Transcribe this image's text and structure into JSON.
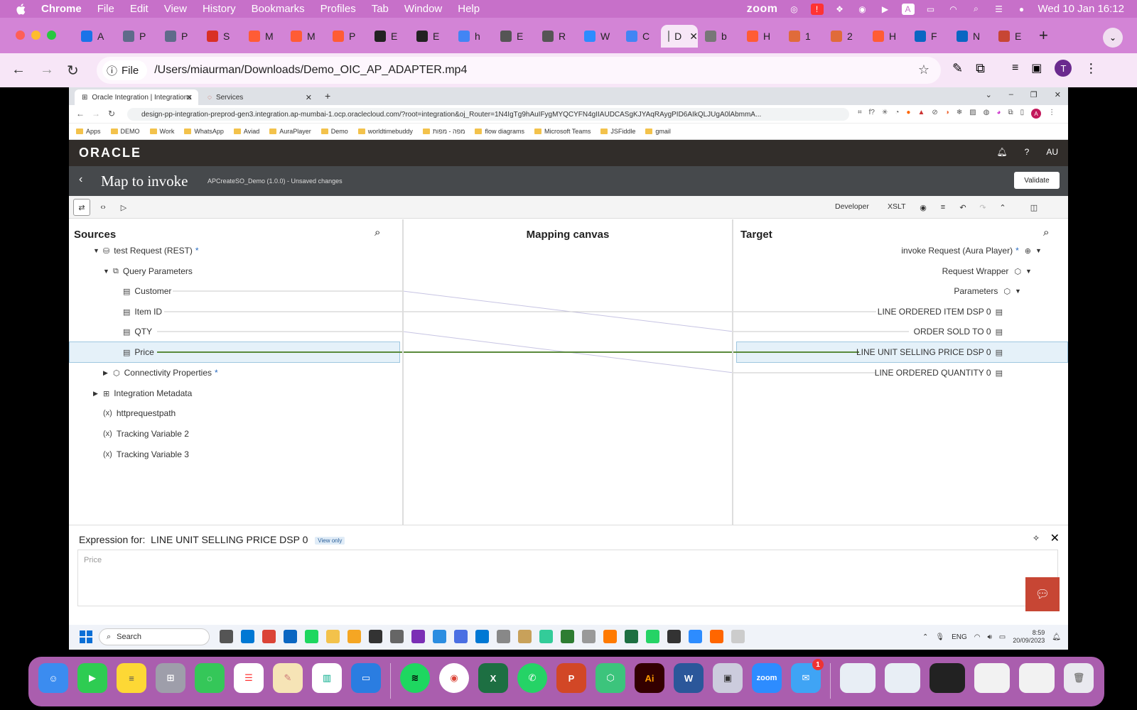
{
  "mac_menubar": {
    "app": "Chrome",
    "items": [
      "File",
      "Edit",
      "View",
      "History",
      "Bookmarks",
      "Profiles",
      "Tab",
      "Window",
      "Help"
    ],
    "zoom_label": "zoom",
    "datetime": "Wed 10 Jan  16:12"
  },
  "chrome": {
    "tabs": [
      {
        "letter": "A",
        "color": "#1a73e8"
      },
      {
        "letter": "P",
        "color": "#5f6b8a"
      },
      {
        "letter": "P",
        "color": "#5f6b8a"
      },
      {
        "letter": "S",
        "color": "#d93025"
      },
      {
        "letter": "M",
        "color": "#ff5c35"
      },
      {
        "letter": "M",
        "color": "#ff5c35"
      },
      {
        "letter": "P",
        "color": "#ff5c35"
      },
      {
        "letter": "E",
        "color": "#222222"
      },
      {
        "letter": "E",
        "color": "#222222"
      },
      {
        "letter": "h",
        "color": "#4285f4"
      },
      {
        "letter": "E",
        "color": "#555555"
      },
      {
        "letter": "R",
        "color": "#555555"
      },
      {
        "letter": "W",
        "color": "#2d8cff"
      },
      {
        "letter": "C",
        "color": "#4285f4"
      },
      {
        "letter": "D",
        "color": "#888888",
        "active": true
      },
      {
        "letter": "b",
        "color": "#777777"
      },
      {
        "letter": "H",
        "color": "#ff5c35"
      },
      {
        "letter": "1",
        "color": "#e06b3a"
      },
      {
        "letter": "2",
        "color": "#e06b3a"
      },
      {
        "letter": "H",
        "color": "#ff5c35"
      },
      {
        "letter": "F",
        "color": "#0a66c2"
      },
      {
        "letter": "N",
        "color": "#0a66c2"
      },
      {
        "letter": "E",
        "color": "#c74634"
      }
    ],
    "new_tab": "+",
    "file_badge": "File",
    "url": "/Users/miaurman/Downloads/Demo_OIC_AP_ADAPTER.mp4",
    "avatar": "T"
  },
  "inner_browser": {
    "tab_active": "Oracle Integration | Integrations",
    "tab_other": "Services",
    "url": "design-pp-integration-preprod-gen3.integration.ap-mumbai-1.ocp.oraclecloud.com/?root=integration&oj_Router=1N4IgTg9hAuIFygMYQCYFN4gIIAUDCASgKJYAqRAygPID6AIkQLJUgA0lAbmmA...",
    "avatar": "A",
    "bookmarks": [
      "Apps",
      "DEMO",
      "Work",
      "WhatsApp",
      "Aviad",
      "AuraPlayer",
      "Demo",
      "worldtimebuddy",
      "מפה - מפות",
      "flow diagrams",
      "Microsoft Teams",
      "JSFiddle",
      "gmail"
    ]
  },
  "oracle": {
    "logo": "ORACLE",
    "user": "AU",
    "page_title": "Map to invoke",
    "subtitle": "APCreateSO_Demo (1.0.0) - Unsaved changes",
    "validate": "Validate",
    "developer": "Developer",
    "xslt": "XSLT"
  },
  "sources": {
    "title": "Sources",
    "root": "test Request (REST)",
    "query_params": "Query Parameters",
    "fields": [
      "Customer",
      "Item ID",
      "QTY",
      "Price"
    ],
    "connectivity": "Connectivity Properties",
    "metadata": "Integration Metadata",
    "vars": [
      "httprequestpath",
      "Tracking Variable 2",
      "Tracking Variable 3"
    ],
    "asterisk": "*"
  },
  "canvas": {
    "title": "Mapping canvas"
  },
  "target": {
    "title": "Target",
    "root": "invoke Request (Aura Player)",
    "wrapper": "Request Wrapper",
    "params": "Parameters",
    "fields": [
      "LINE ORDERED ITEM DSP 0",
      "ORDER SOLD TO 0",
      "LINE UNIT SELLING PRICE DSP 0",
      "LINE ORDERED QUANTITY 0"
    ]
  },
  "expression": {
    "label": "Expression for:",
    "target": "LINE UNIT SELLING PRICE DSP 0",
    "badge": "View only",
    "value": "Price"
  },
  "win_taskbar": {
    "search": "Search",
    "lang": "ENG",
    "time": "8:59",
    "date": "20/09/2023"
  },
  "dock": {
    "mail_badge": "1",
    "ai_label": "Ai",
    "word_label": "W",
    "zoom_label": "zoom"
  }
}
